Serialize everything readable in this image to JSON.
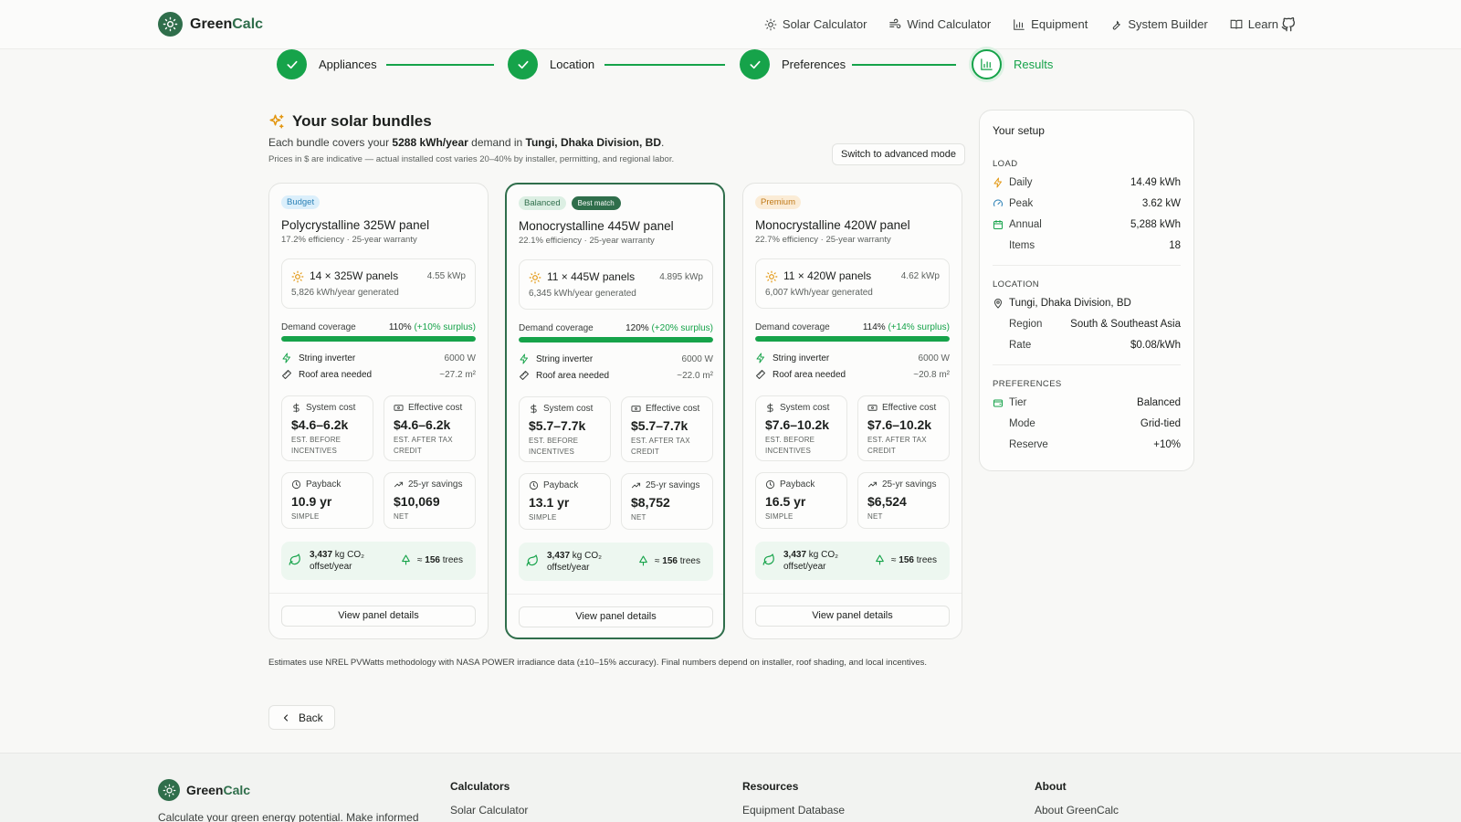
{
  "brand": {
    "name_part1": "Green",
    "name_part2": "Calc"
  },
  "nav": [
    {
      "label": "Solar Calculator",
      "icon": "sun-icon"
    },
    {
      "label": "Wind Calculator",
      "icon": "wind-icon"
    },
    {
      "label": "Equipment",
      "icon": "chart-icon"
    },
    {
      "label": "System Builder",
      "icon": "wrench-icon"
    },
    {
      "label": "Learn",
      "icon": "book-icon"
    }
  ],
  "steps": [
    {
      "label": "Appliances",
      "state": "done"
    },
    {
      "label": "Location",
      "state": "done"
    },
    {
      "label": "Preferences",
      "state": "done"
    },
    {
      "label": "Results",
      "state": "current"
    }
  ],
  "header": {
    "title": "Your solar bundles",
    "sub_prefix": "Each bundle covers your ",
    "sub_demand": "5288 kWh/year",
    "sub_middle": " demand in ",
    "sub_location": "Tungi, Dhaka Division, BD",
    "sub_suffix": ".",
    "note": "Prices in $ are indicative — actual installed cost varies 20–40% by installer, permitting, and regional labor.",
    "advanced_button": "Switch to advanced mode"
  },
  "cards": [
    {
      "tier": "Budget",
      "tier_style": "budget",
      "best_match": "",
      "title": "Polycrystalline 325W panel",
      "spec": "17.2% efficiency · 25-year warranty",
      "panels": "14 × 325W panels",
      "kwp": "4.55 kWp",
      "generated": "5,826 kWh/year generated",
      "coverage_label": "Demand coverage",
      "coverage": "110%",
      "surplus": "(+10% surplus)",
      "coverage_fraction": 1.0,
      "inverter_label": "String inverter",
      "inverter": "6000 W",
      "roof_label": "Roof area needed",
      "roof": "~27.2 m²",
      "system_cost_label": "System cost",
      "system_cost": "$4.6–6.2k",
      "system_cost_sub": "EST. BEFORE INCENTIVES",
      "effective_cost_label": "Effective cost",
      "effective_cost": "$4.6–6.2k",
      "effective_cost_sub": "EST. AFTER TAX CREDIT",
      "payback_label": "Payback",
      "payback": "10.9 yr",
      "payback_sub": "SIMPLE",
      "savings_label": "25-yr savings",
      "savings": "$10,069",
      "savings_sub": "NET",
      "co2_value": "3,437",
      "co2_unit": " kg CO₂ offset/year",
      "trees_prefix": "≈ ",
      "trees_value": "156",
      "trees_unit": " trees",
      "details_button": "View panel details"
    },
    {
      "tier": "Balanced",
      "tier_style": "balanced",
      "best_match": "Best match",
      "title": "Monocrystalline 445W panel",
      "spec": "22.1% efficiency · 25-year warranty",
      "panels": "11 × 445W panels",
      "kwp": "4.895 kWp",
      "generated": "6,345 kWh/year generated",
      "coverage_label": "Demand coverage",
      "coverage": "120%",
      "surplus": "(+20% surplus)",
      "coverage_fraction": 1.0,
      "inverter_label": "String inverter",
      "inverter": "6000 W",
      "roof_label": "Roof area needed",
      "roof": "~22.0 m²",
      "system_cost_label": "System cost",
      "system_cost": "$5.7–7.7k",
      "system_cost_sub": "EST. BEFORE INCENTIVES",
      "effective_cost_label": "Effective cost",
      "effective_cost": "$5.7–7.7k",
      "effective_cost_sub": "EST. AFTER TAX CREDIT",
      "payback_label": "Payback",
      "payback": "13.1 yr",
      "payback_sub": "SIMPLE",
      "savings_label": "25-yr savings",
      "savings": "$8,752",
      "savings_sub": "NET",
      "co2_value": "3,437",
      "co2_unit": " kg CO₂ offset/year",
      "trees_prefix": "≈ ",
      "trees_value": "156",
      "trees_unit": " trees",
      "details_button": "View panel details"
    },
    {
      "tier": "Premium",
      "tier_style": "premium",
      "best_match": "",
      "title": "Monocrystalline 420W panel",
      "spec": "22.7% efficiency · 25-year warranty",
      "panels": "11 × 420W panels",
      "kwp": "4.62 kWp",
      "generated": "6,007 kWh/year generated",
      "coverage_label": "Demand coverage",
      "coverage": "114%",
      "surplus": "(+14% surplus)",
      "coverage_fraction": 1.0,
      "inverter_label": "String inverter",
      "inverter": "6000 W",
      "roof_label": "Roof area needed",
      "roof": "~20.8 m²",
      "system_cost_label": "System cost",
      "system_cost": "$7.6–10.2k",
      "system_cost_sub": "EST. BEFORE INCENTIVES",
      "effective_cost_label": "Effective cost",
      "effective_cost": "$7.6–10.2k",
      "effective_cost_sub": "EST. AFTER TAX CREDIT",
      "payback_label": "Payback",
      "payback": "16.5 yr",
      "payback_sub": "SIMPLE",
      "savings_label": "25-yr savings",
      "savings": "$6,524",
      "savings_sub": "NET",
      "co2_value": "3,437",
      "co2_unit": " kg CO₂ offset/year",
      "trees_prefix": "≈ ",
      "trees_value": "156",
      "trees_unit": " trees",
      "details_button": "View panel details"
    }
  ],
  "setup": {
    "title": "Your setup",
    "load_heading": "LOAD",
    "load": [
      {
        "label": "Daily",
        "value": "14.49 kWh"
      },
      {
        "label": "Peak",
        "value": "3.62 kW"
      },
      {
        "label": "Annual",
        "value": "5,288 kWh"
      },
      {
        "label": "Items",
        "value": "18"
      }
    ],
    "location_heading": "LOCATION",
    "location_name": "Tungi, Dhaka Division, BD",
    "location": [
      {
        "label": "Region",
        "value": "South & Southeast Asia"
      },
      {
        "label": "Rate",
        "value": "$0.08/kWh"
      }
    ],
    "preferences_heading": "PREFERENCES",
    "preferences": [
      {
        "label": "Tier",
        "value": "Balanced"
      },
      {
        "label": "Mode",
        "value": "Grid-tied"
      },
      {
        "label": "Reserve",
        "value": "+10%"
      }
    ]
  },
  "disclaimer": "Estimates use NREL PVWatts methodology with NASA POWER irradiance data (±10–15% accuracy). Final numbers depend on installer, roof shading, and local incentives.",
  "back_button": "Back",
  "footer": {
    "tagline": "Calculate your green energy potential. Make informed",
    "columns": [
      {
        "heading": "Calculators",
        "link": "Solar Calculator"
      },
      {
        "heading": "Resources",
        "link": "Equipment Database"
      },
      {
        "heading": "About",
        "link": "About GreenCalc"
      }
    ]
  },
  "colors": {
    "accent": "#16a34a",
    "brand": "#2f6e4b",
    "budget": "#2d82b7",
    "premium": "#c07a19"
  }
}
